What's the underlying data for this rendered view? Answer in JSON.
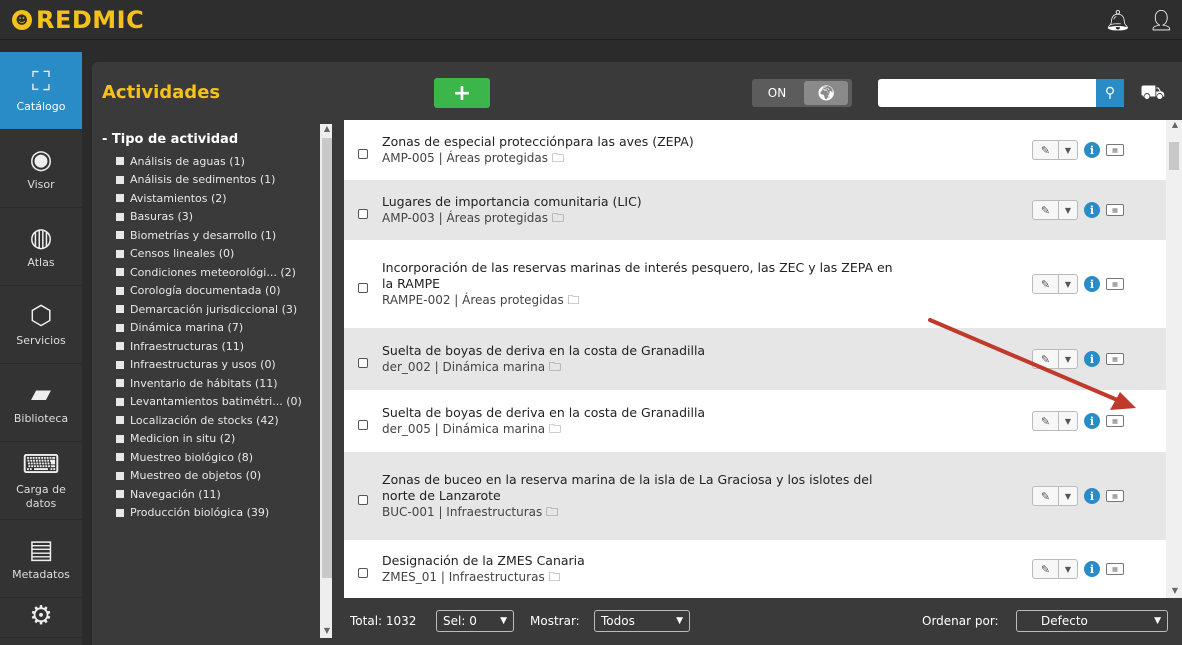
{
  "app": {
    "logo_text": "REDMIC"
  },
  "topbar": {
    "bell_icon": "bell-icon",
    "user_icon": "user-icon"
  },
  "nav": [
    {
      "label": "Catálogo",
      "icon": "sitemap-icon",
      "active": true
    },
    {
      "label": "Visor",
      "icon": "eye-icon"
    },
    {
      "label": "Atlas",
      "icon": "globe-icon"
    },
    {
      "label": "Servicios",
      "icon": "hexagons-icon"
    },
    {
      "label": "Biblioteca",
      "icon": "book-icon"
    },
    {
      "label": "Carga de datos",
      "icon": "keyboard-icon"
    },
    {
      "label": "Metadatos",
      "icon": "archive-icon"
    },
    {
      "label": "",
      "icon": "gears-icon"
    }
  ],
  "panel": {
    "title": "Actividades",
    "add_label": "+",
    "toggle_label": "ON",
    "search_placeholder": ""
  },
  "facet": {
    "title": "- Tipo de actividad",
    "items": [
      "Análisis de aguas (1)",
      "Análisis de sedimentos (1)",
      "Avistamientos (2)",
      "Basuras (3)",
      "Biometrías y desarrollo (1)",
      "Censos lineales (0)",
      "Condiciones meteorológi...  (2)",
      "Corología documentada (0)",
      "Demarcación jurisdiccional (3)",
      "Dinámica marina (7)",
      "Infraestructuras (11)",
      "Infraestructuras y usos (0)",
      "Inventario de hábitats (11)",
      "Levantamientos batimétri...  (0)",
      "Localización de stocks (42)",
      "Medicion in situ (2)",
      "Muestreo biológico (8)",
      "Muestreo de objetos (0)",
      "Navegación (11)",
      "Producción biológica (39)"
    ]
  },
  "rows": [
    {
      "title": "Zonas de especial protecciónpara las aves (ZEPA)",
      "sub": "AMP-005 | Áreas protegidas"
    },
    {
      "title": "Lugares de importancia comunitaria (LIC)",
      "sub": "AMP-003 | Áreas protegidas"
    },
    {
      "title": "Incorporación de las reservas marinas de interés pesquero, las ZEC y las ZEPA en la RAMPE",
      "sub": "RAMPE-002 | Áreas protegidas"
    },
    {
      "title": "Suelta de boyas de deriva en la costa de Granadilla",
      "sub": "der_002 | Dinámica marina"
    },
    {
      "title": "Suelta de boyas de deriva en la costa de Granadilla",
      "sub": "der_005 | Dinámica marina"
    },
    {
      "title": "Zonas de buceo en la reserva marina de la isla de La Graciosa y los islotes del norte de Lanzarote",
      "sub": "BUC-001 | Infraestructuras"
    },
    {
      "title": "Designación de la ZMES Canaria",
      "sub": "ZMES_01 | Infraestructuras"
    }
  ],
  "footer": {
    "total_label": "Total: 1032",
    "sel_label": "Sel:  0",
    "show_label": "Mostrar:",
    "show_value": "Todos",
    "order_label": "Ordenar por:",
    "order_value": "Defecto"
  },
  "colors": {
    "accent": "#2a8cc7",
    "brand": "#f4c21a",
    "add": "#3cb54a",
    "annotation": "#c0392b"
  }
}
